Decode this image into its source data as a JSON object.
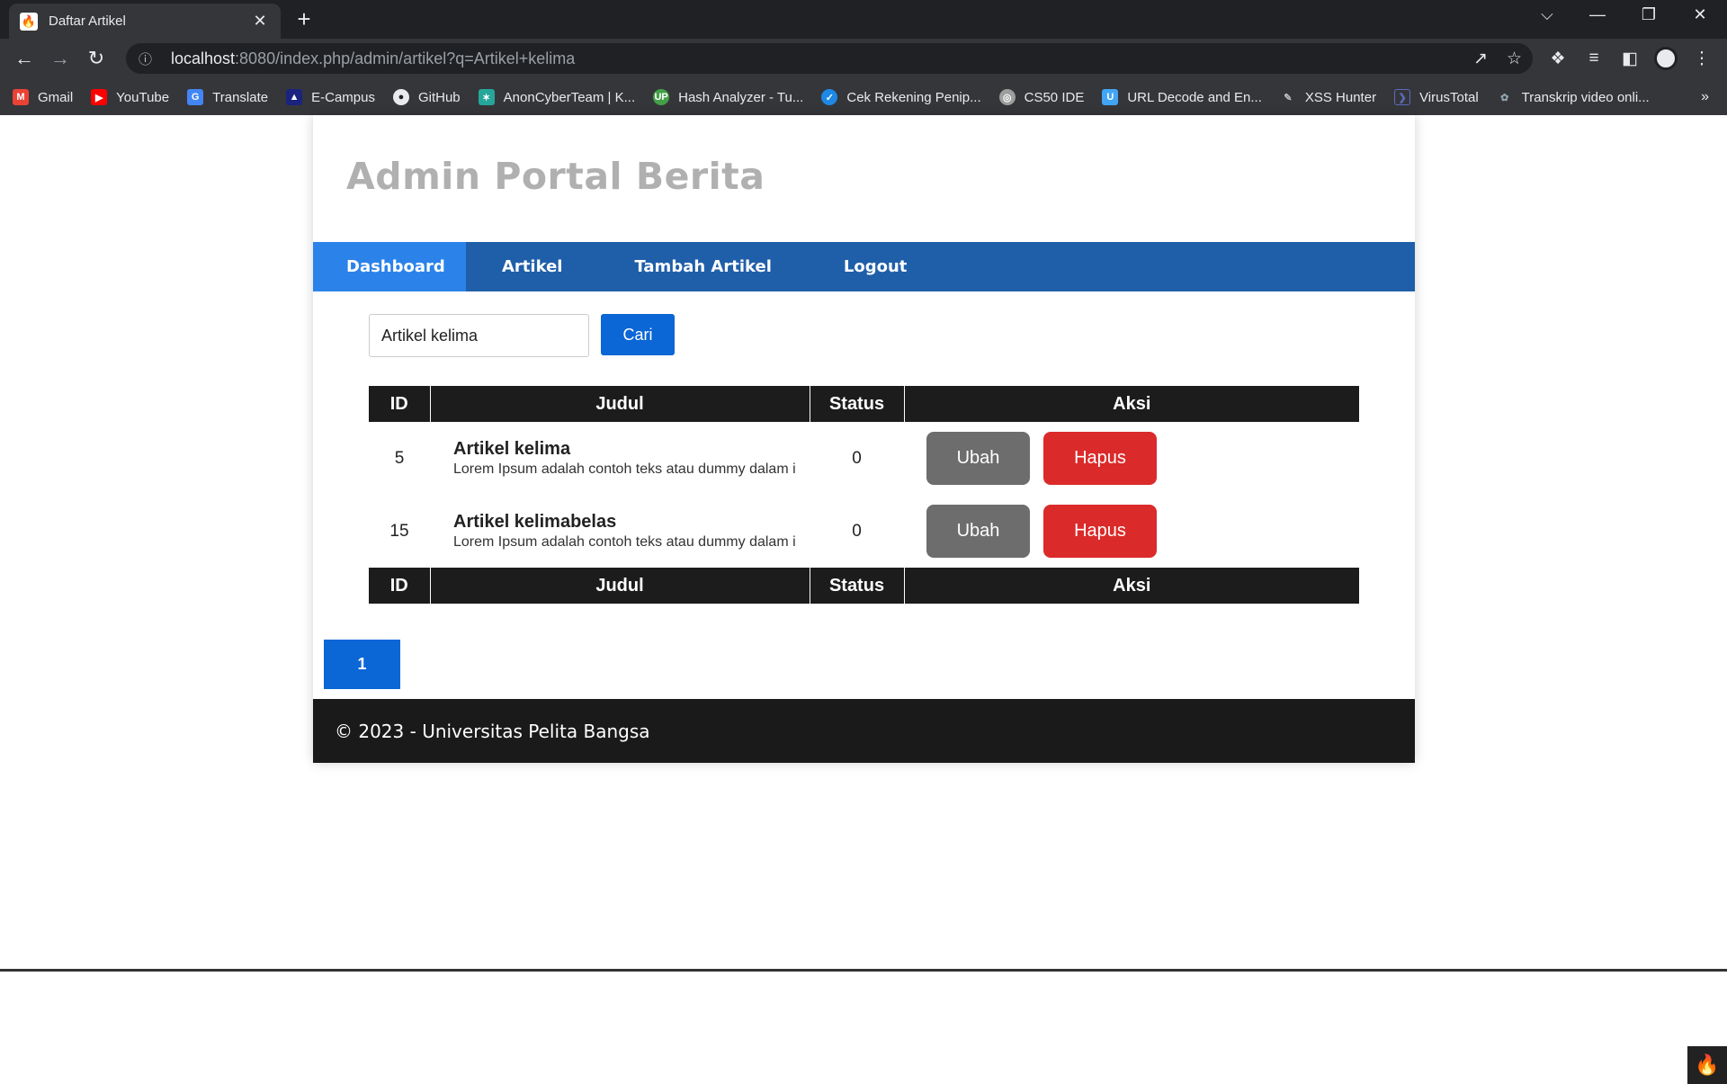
{
  "browser": {
    "tab_title": "Daftar Artikel",
    "tab_close": "✕",
    "new_tab": "+",
    "url_host": "localhost",
    "url_rest": ":8080/index.php/admin/artikel?q=Artikel+kelima",
    "bookmarks": [
      {
        "label": "Gmail",
        "icon": "gmail-icon",
        "color": "#ea4335"
      },
      {
        "label": "YouTube",
        "icon": "youtube-icon",
        "color": "#ff0000"
      },
      {
        "label": "Translate",
        "icon": "translate-icon",
        "color": "#4285f4"
      },
      {
        "label": "E-Campus",
        "icon": "ecampus-icon",
        "color": "#1a237e"
      },
      {
        "label": "GitHub",
        "icon": "github-icon",
        "color": "#e8eaed"
      },
      {
        "label": "AnonCyberTeam | K...",
        "icon": "anoncyberteam-icon",
        "color": "#26a69a"
      },
      {
        "label": "Hash Analyzer - Tu...",
        "icon": "hash-analyzer-icon",
        "color": "#43a047"
      },
      {
        "label": "Cek Rekening Penip...",
        "icon": "cek-rekening-icon",
        "color": "#1e88e5"
      },
      {
        "label": "CS50 IDE",
        "icon": "cs50-icon",
        "color": "#9e9e9e"
      },
      {
        "label": "URL Decode and En...",
        "icon": "url-decode-icon",
        "color": "#42a5f5"
      },
      {
        "label": "XSS Hunter",
        "icon": "xss-hunter-icon",
        "color": "#bdbdbd"
      },
      {
        "label": "VirusTotal",
        "icon": "virustotal-icon",
        "color": "#3949ab"
      },
      {
        "label": "Transkrip video onli...",
        "icon": "transkrip-icon",
        "color": "#90a4ae"
      }
    ],
    "bookmarks_more": "»"
  },
  "site": {
    "title": "Admin Portal Berita",
    "nav": [
      "Dashboard",
      "Artikel",
      "Tambah Artikel",
      "Logout"
    ],
    "search": {
      "value": "Artikel kelima",
      "button": "Cari"
    },
    "table": {
      "headers": [
        "ID",
        "Judul",
        "Status",
        "Aksi"
      ],
      "rows": [
        {
          "id": "5",
          "title": "Artikel kelima",
          "excerpt": "Lorem Ipsum adalah contoh teks atau dummy dalam i",
          "status": "0",
          "edit": "Ubah",
          "delete": "Hapus"
        },
        {
          "id": "15",
          "title": "Artikel kelimabelas",
          "excerpt": "Lorem Ipsum adalah contoh teks atau dummy dalam i",
          "status": "0",
          "edit": "Ubah",
          "delete": "Hapus"
        }
      ]
    },
    "pagination": [
      "1"
    ],
    "footer": "© 2023 - Universitas Pelita Bangsa"
  },
  "colors": {
    "nav_bg": "#1f5faa",
    "nav_active": "#2b83ea",
    "primary_button": "#0b66d6",
    "edit_button": "#6d6d6d",
    "delete_button": "#db2a2a",
    "table_header": "#1c1c1c"
  }
}
